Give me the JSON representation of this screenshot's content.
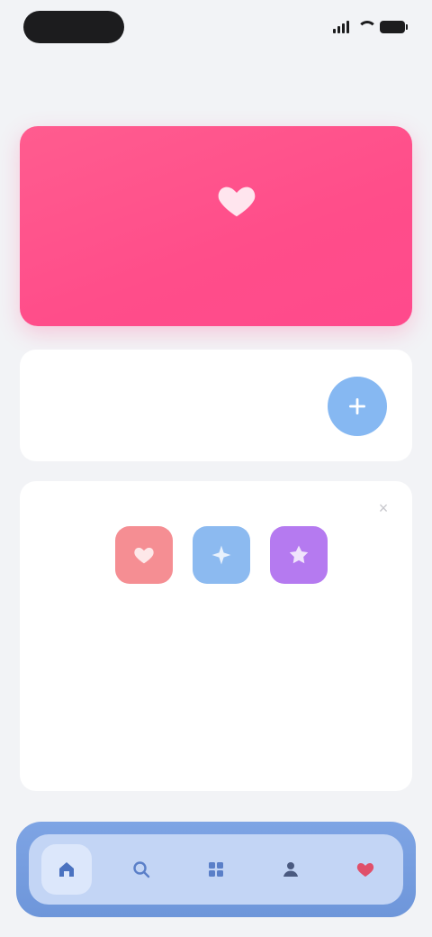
{
  "status_bar": {
    "time": "",
    "icons": [
      "signal-icon",
      "wifi-icon",
      "battery-icon"
    ]
  },
  "nav": {
    "title": ""
  },
  "hero": {
    "icon": "heart-icon",
    "color": "#ff4d8a"
  },
  "row": {
    "label": "",
    "button_icon": "plus-icon",
    "button_color": "#86b8f2"
  },
  "feature": {
    "dots": [
      {
        "icon": "heart-icon",
        "color": "#f58e93"
      },
      {
        "icon": "sparkle-icon",
        "color": "#8cbaf0"
      },
      {
        "icon": "star-icon",
        "color": "#b57af0"
      }
    ],
    "title": "",
    "description": "",
    "link": ""
  },
  "tab_bar": {
    "items": [
      {
        "icon": "home-icon",
        "active": true
      },
      {
        "icon": "search-icon",
        "active": false
      },
      {
        "icon": "grid-icon",
        "active": false
      },
      {
        "icon": "person-icon",
        "active": false
      },
      {
        "icon": "heart-icon",
        "active": false
      }
    ],
    "color": "#6e96da"
  }
}
